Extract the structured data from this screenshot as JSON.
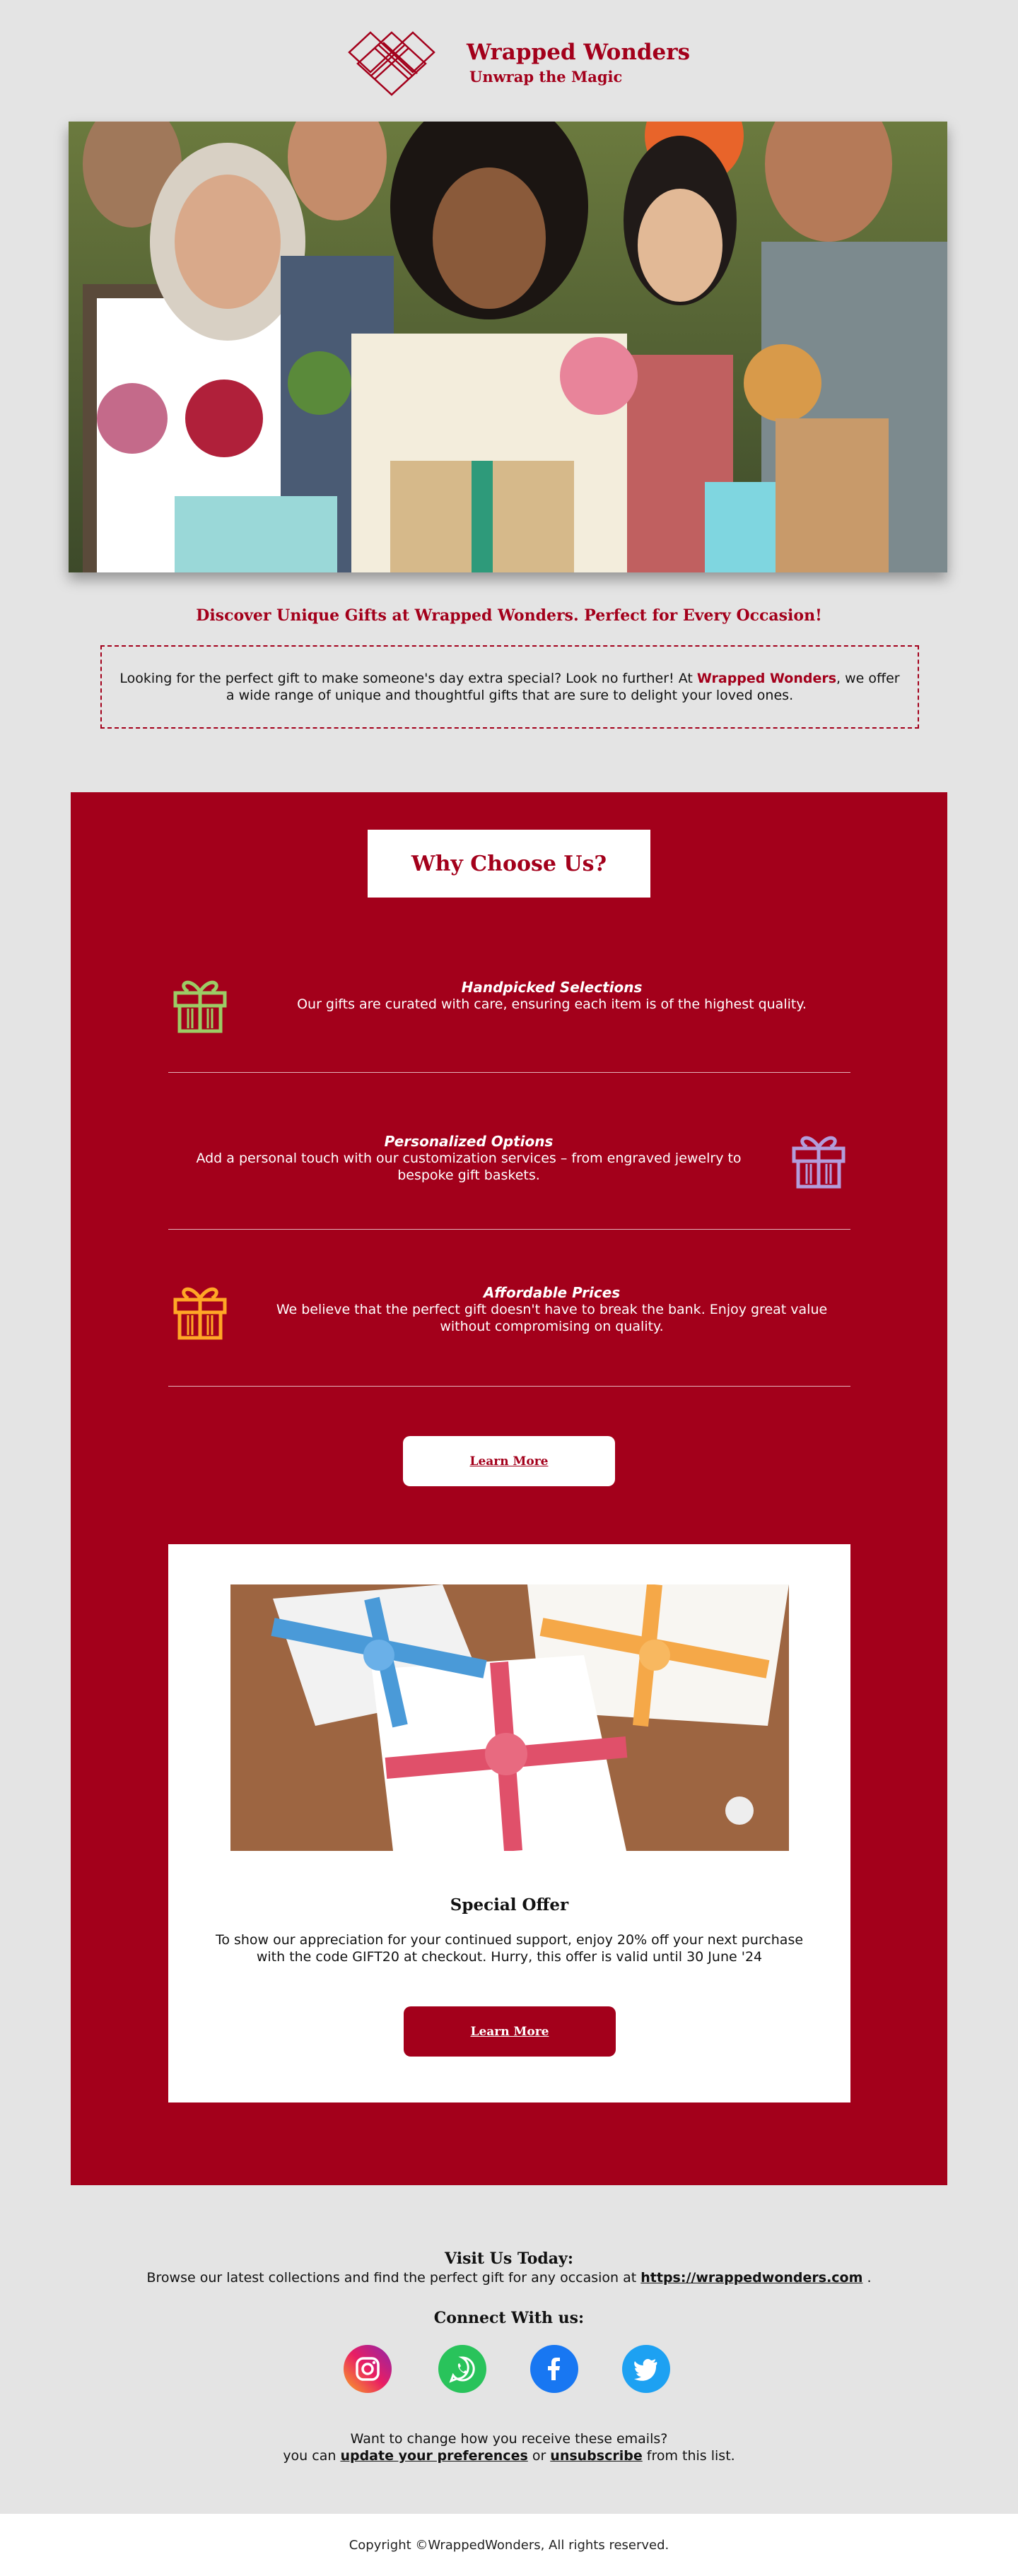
{
  "brand": {
    "name": "Wrapped Wonders",
    "tagline": "Unwrap the Magic",
    "color": "#a3001b"
  },
  "hero": {
    "image": "photo-of-laughing-people-holding-gifts-and-flowers"
  },
  "discover_heading": "Discover Unique Gifts at Wrapped Wonders.  Perfect for Every Occasion!",
  "intro": {
    "text_before": "Looking for the perfect gift to make someone's day extra special? Look no further! At ",
    "highlight": "Wrapped Wonders",
    "text_after": ", we offer a wide range of unique and thoughtful gifts that are sure to delight your loved ones."
  },
  "why": {
    "title": "Why Choose Us?",
    "features": [
      {
        "title": "Handpicked Selections",
        "text": "Our gifts are curated with care, ensuring each item is of the highest quality.",
        "icon": "gift-icon",
        "icon_color": "#9ccc65"
      },
      {
        "title": "Personalized Options",
        "text": "Add a personal touch with our customization services – from engraved jewelry to bespoke gift baskets.",
        "icon": "gift-icon",
        "icon_color": "#b39ddb"
      },
      {
        "title": "Affordable Prices",
        "text": "We believe that the perfect gift doesn't have to break the bank. Enjoy great value without compromising on quality.",
        "icon": "gift-icon",
        "icon_color": "#ffa726"
      }
    ],
    "learn_more_label": "Learn More"
  },
  "offer": {
    "image": "photo-of-wrapped-gift-boxes-with-ribbons",
    "title": "Special Offer",
    "text": "To show our appreciation for your continued support, enjoy 20% off your next purchase with the code GIFT20 at checkout. Hurry, this offer is valid until 30 June '24",
    "learn_more_label": "Learn More"
  },
  "visit": {
    "title": "Visit Us Today:",
    "text": "Browse our latest collections and find the perfect gift for any occasion at ",
    "link": "https://wrappedwonders.com",
    "after": " ."
  },
  "connect": {
    "title": "Connect With us:",
    "socials": [
      {
        "name": "instagram-icon"
      },
      {
        "name": "whatsapp-icon"
      },
      {
        "name": "facebook-icon"
      },
      {
        "name": "twitter-icon"
      }
    ]
  },
  "prefs": {
    "line1": "Want to change how you receive these emails?",
    "line2_before": "you can ",
    "update_link": "update your preferences",
    "or": " or ",
    "unsubscribe_link": "unsubscribe",
    "line2_after": " from this list."
  },
  "copyright": "Copyright ©WrappedWonders, All rights reserved."
}
